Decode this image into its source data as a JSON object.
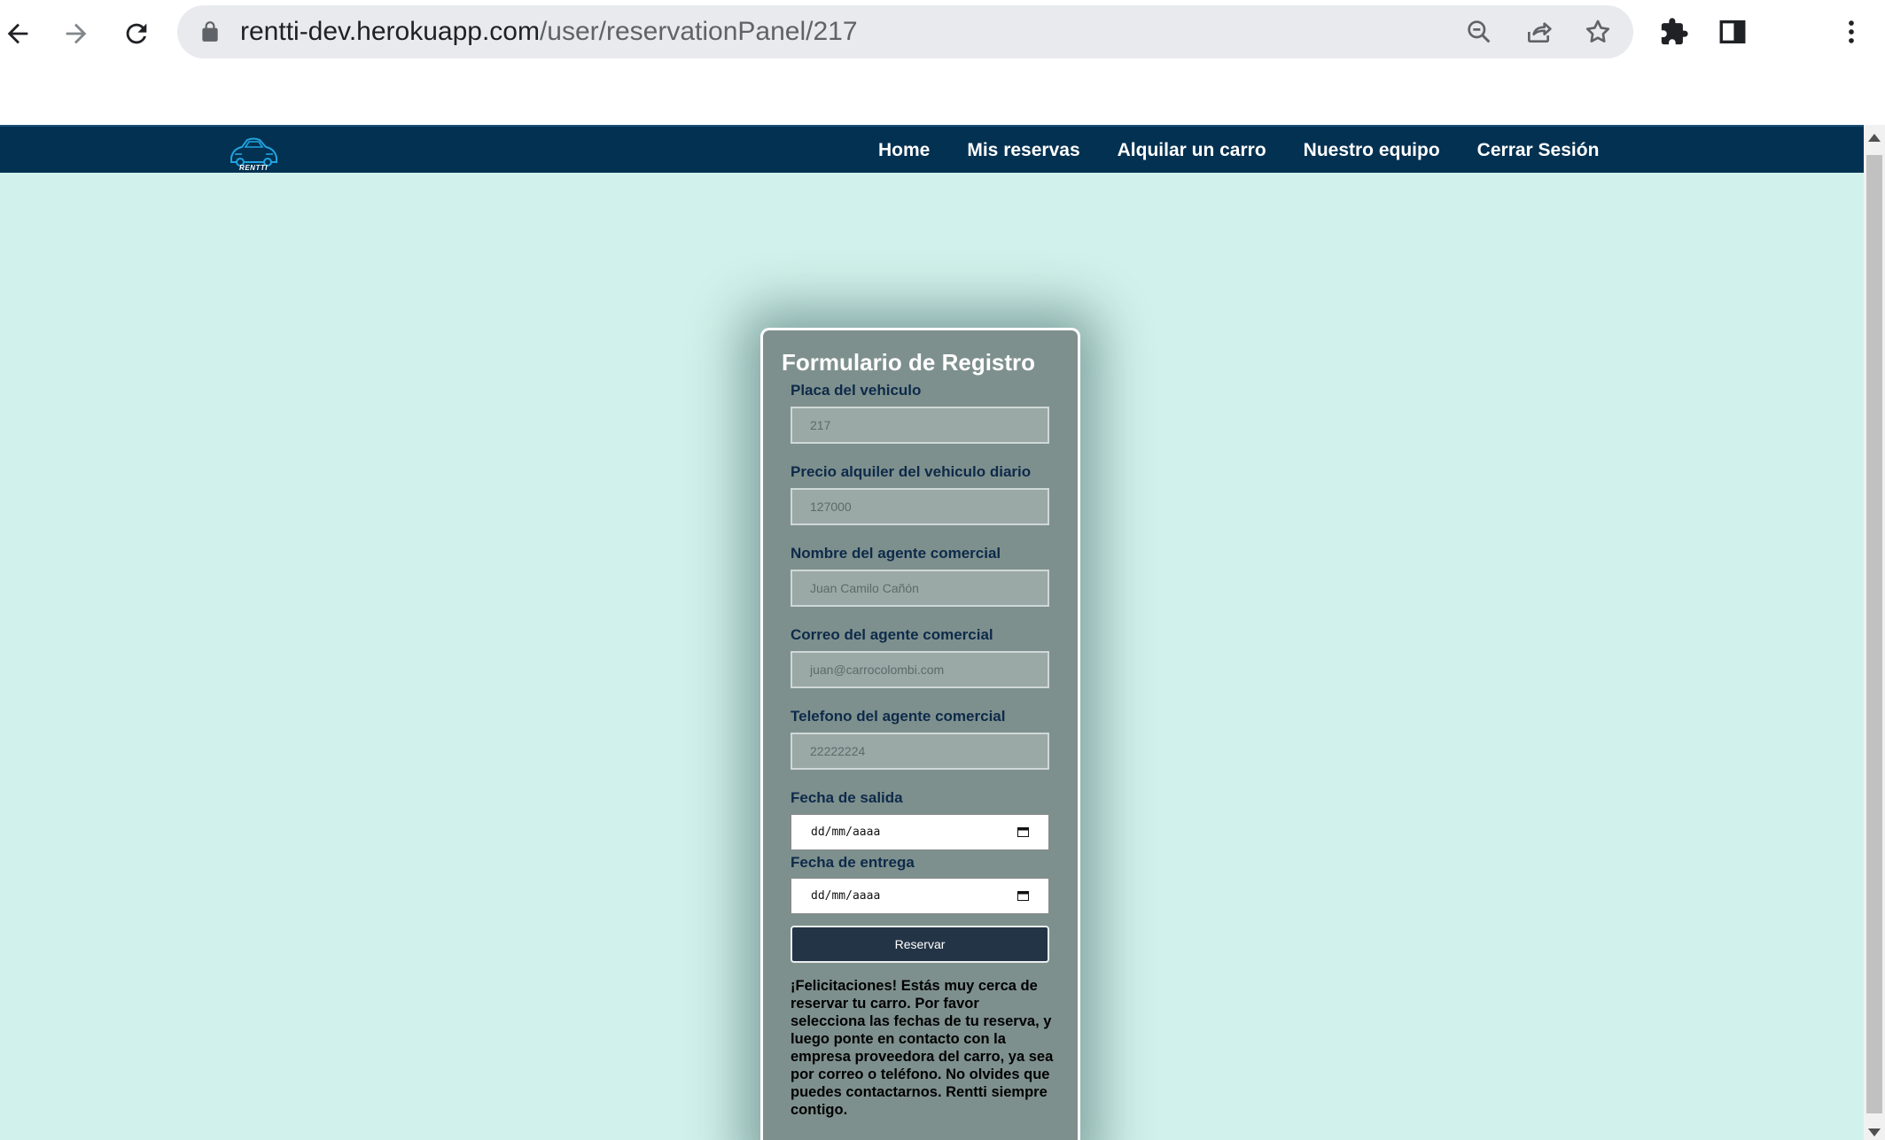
{
  "browser": {
    "url_host": "rentti-dev.herokuapp.com",
    "url_path": "/user/reservationPanel/217"
  },
  "nav": {
    "brand": "RENTTI",
    "links": [
      "Home",
      "Mis reservas",
      "Alquilar un carro",
      "Nuestro equipo",
      "Cerrar Sesión"
    ]
  },
  "form": {
    "title": "Formulario de Registro",
    "fields": [
      {
        "label": "Placa del vehiculo",
        "value": "217"
      },
      {
        "label": "Precio alquiler del vehiculo diario",
        "value": "127000"
      },
      {
        "label": "Nombre del agente comercial",
        "value": "Juan Camilo Cañón"
      },
      {
        "label": "Correo del agente comercial",
        "value": "juan@carrocolombi.com"
      },
      {
        "label": "Telefono del agente comercial",
        "value": "22222224"
      }
    ],
    "dates": [
      {
        "label": "Fecha de salida",
        "placeholder": "dd/mm/aaaa"
      },
      {
        "label": "Fecha de entrega",
        "placeholder": "dd/mm/aaaa"
      }
    ],
    "submit_label": "Reservar",
    "message": "¡Felicitaciones! Estás muy cerca de reservar tu carro. Por favor selecciona las fechas de tu reserva, y luego ponte en contacto con la empresa proveedora del carro, ya sea por correo o teléfono. No olvides que puedes contactarnos. Rentti siempre contigo."
  },
  "colors": {
    "nav_bg": "#033151",
    "page_bg": "#d1f2ec",
    "card_bg": "#7e908d",
    "button_bg": "#233446",
    "label": "#0d2a4a"
  },
  "icons": [
    "back-icon",
    "forward-icon",
    "reload-icon",
    "lock-icon",
    "zoom-out-icon",
    "share-icon",
    "bookmark-star-icon",
    "extensions-icon",
    "side-panel-icon",
    "menu-kebab-icon",
    "calendar-icon",
    "car-logo-icon"
  ]
}
